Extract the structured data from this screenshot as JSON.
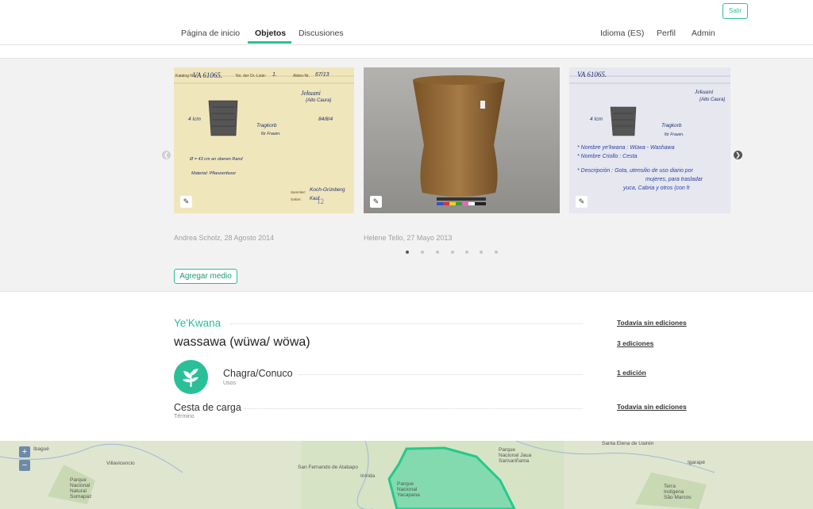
{
  "header": {
    "logout_label": "Salir",
    "nav_left": [
      "Página de inicio",
      "Objetos",
      "Discusiones"
    ],
    "nav_right": [
      "Idioma (ES)",
      "Perfil",
      "Admin"
    ],
    "active_tab": "Objetos"
  },
  "gallery": {
    "captions": [
      "Andrea Scholz, 28 Agosto 2014",
      "Helene Tello, 27 Mayo 2013"
    ],
    "dot_count": 7,
    "active_dot": 1,
    "add_media_label": "Agregar medio",
    "card1": {
      "katalog_label": "Katalog No.",
      "katalog_value": "VA 61065.",
      "ortliste_label": "No. der Or.-Liste:",
      "ortliste_value": "1.",
      "akten_label": "Akten-Nr.",
      "akten_value": "67/13",
      "tribe": "Jekuani",
      "region": "(Alto Caura)",
      "date_code": "84/8/4",
      "height": "4 Icm",
      "name": "Tragkorb",
      "for": "für Frauen.",
      "dims": "Ø = 43 cm an oberen Rand",
      "material": "Material: Pflanzenfaser",
      "sammler_label": "Sammler:",
      "sammler_value": "Koch-Grünberg",
      "geber_label": "Geber:",
      "geber_value": "Kauf.",
      "page_num": "12"
    },
    "card3": {
      "katalog_value": "VA 61065.",
      "tribe": "Jekuani",
      "region": "(Alto Caura)",
      "height": "4 Icm",
      "name": "Tragkorb",
      "for": "für Frauen.",
      "line1": "* Nombre ye'kwana : Wüwa - Washawa",
      "line2": "* Nombre Criollo : Cesta",
      "line3": "* Descripción : Gota, utensilio de uso diario por",
      "line4": "mujeres, para trasladar",
      "line5": "yuca, Cabria y otros (con fr"
    }
  },
  "object": {
    "language": "Ye'Kwana",
    "language_edits": "Todavía sin ediciones",
    "word": "wassawa (wüwa/ wöwa)",
    "word_edits": "3 ediciones",
    "uses_value": "Chagra/Conuco",
    "uses_label": "Usos",
    "uses_edits": "1 edición",
    "term_value": "Cesta de carga",
    "term_label": "Término",
    "term_edits": "Todavía sin ediciones"
  },
  "map": {
    "zoom_in": "+",
    "zoom_out": "−",
    "labels": [
      "Ibagué",
      "Villavicencio",
      "Parque Nacional Natural Sumapaz",
      "San Fernando de Atabapo",
      "Inírida",
      "Parque Nacional Yacapana",
      "Parque Nacional Jaua Sarisariñama",
      "Santa Elena de Uairén",
      "Igarapé",
      "Terra Indígena São Marcos"
    ]
  },
  "colors": {
    "accent": "#2bbf98",
    "map_region": "#3fd39a"
  }
}
